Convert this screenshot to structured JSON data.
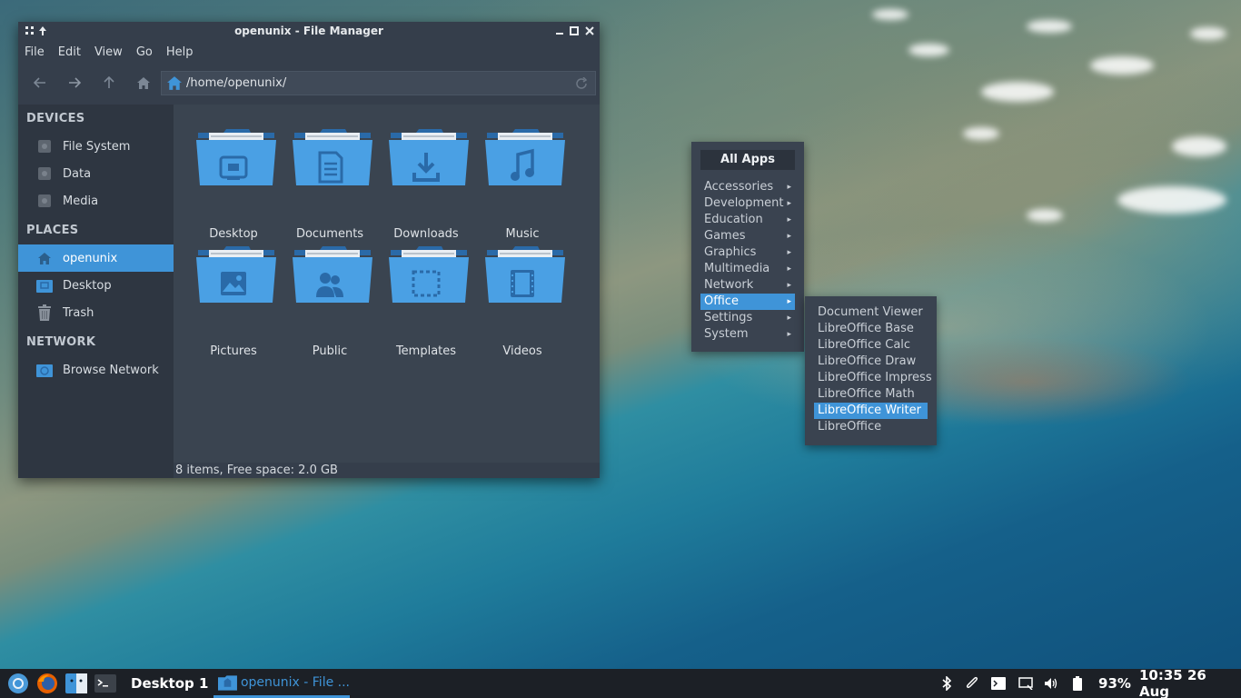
{
  "file_manager": {
    "title": "openunix - File Manager",
    "menu": [
      "File",
      "Edit",
      "View",
      "Go",
      "Help"
    ],
    "address": "/home/openunix/",
    "sidebar": {
      "devices_header": "DEVICES",
      "devices": [
        "File System",
        "Data",
        "Media"
      ],
      "places_header": "PLACES",
      "places": [
        "openunix",
        "Desktop",
        "Trash"
      ],
      "network_header": "NETWORK",
      "network": [
        "Browse Network"
      ]
    },
    "folders": [
      "Desktop",
      "Documents",
      "Downloads",
      "Music",
      "Pictures",
      "Public",
      "Templates",
      "Videos"
    ],
    "status": "8 items, Free space: 2.0 GB"
  },
  "apps_menu": {
    "title": "All Apps",
    "categories": [
      "Accessories",
      "Development",
      "Education",
      "Games",
      "Graphics",
      "Multimedia",
      "Network",
      "Office",
      "Settings",
      "System"
    ],
    "selected_category": "Office",
    "office_items": [
      "Document Viewer",
      "LibreOffice Base",
      "LibreOffice Calc",
      "LibreOffice Draw",
      "LibreOffice Impress",
      "LibreOffice Math",
      "LibreOffice Writer",
      "LibreOffice"
    ],
    "selected_item": "LibreOffice Writer"
  },
  "taskbar": {
    "workspace": "Desktop 1",
    "task": "openunix - File ...",
    "battery": "93%",
    "clock": "10:35 26 Aug"
  },
  "colors": {
    "accent": "#3f94d8",
    "window_bg": "#353e4b",
    "taskbar_bg": "#1c2026"
  },
  "icons": [
    "menu-icon",
    "pin-icon",
    "minimize-icon",
    "maximize-icon",
    "close-icon",
    "back-arrow-icon",
    "forward-arrow-icon",
    "up-arrow-icon",
    "home-icon",
    "refresh-icon",
    "drive-icon",
    "trash-icon",
    "network-icon",
    "folder-icon",
    "chromium-icon",
    "firefox-icon",
    "finder-icon",
    "terminal-icon",
    "bluetooth-icon",
    "paperclip-icon",
    "prompt-icon",
    "screen-icon",
    "volume-icon",
    "battery-icon"
  ]
}
